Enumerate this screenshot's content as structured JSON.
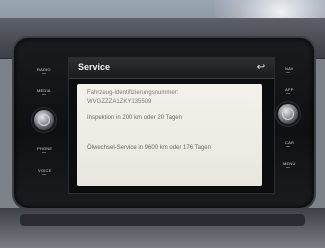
{
  "screen": {
    "title": "Service",
    "back_icon": "back-arrow-icon",
    "lines": [
      "Fahrzeug-Identifizierungsnummer:",
      "WVGZZZA1ZKY135509",
      "Inspektion in 200 km oder 20 Tagen",
      "Ölwechsel-Service in 9600 km oder 176 Tagen"
    ]
  },
  "buttons_left": [
    "RADIO",
    "MEDIA",
    "PHONE",
    "VOICE"
  ],
  "buttons_right": [
    "NAV",
    "APP",
    "CAR",
    "MENU"
  ],
  "colors": {
    "screen_background": "#0c0d0f",
    "panel_background": "#f1eee7",
    "bezel": "#141517"
  }
}
